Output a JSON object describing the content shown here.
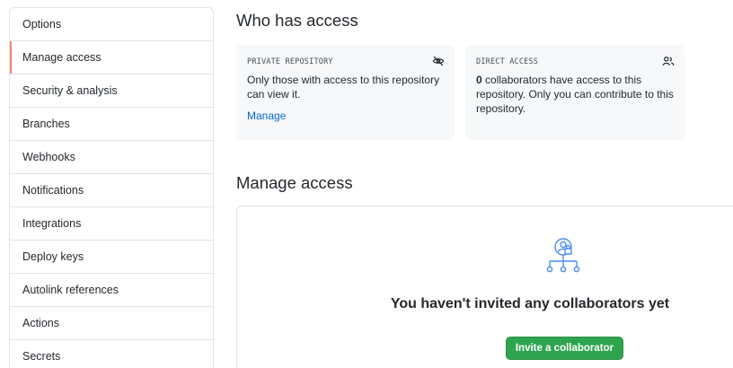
{
  "sidebar": {
    "items": [
      {
        "label": "Options"
      },
      {
        "label": "Manage access"
      },
      {
        "label": "Security & analysis"
      },
      {
        "label": "Branches"
      },
      {
        "label": "Webhooks"
      },
      {
        "label": "Notifications"
      },
      {
        "label": "Integrations"
      },
      {
        "label": "Deploy keys"
      },
      {
        "label": "Autolink references"
      },
      {
        "label": "Actions"
      },
      {
        "label": "Secrets"
      }
    ],
    "selected": "Manage access",
    "accent_color": "#f9826c"
  },
  "who_has_access": {
    "title": "Who has access",
    "private_card": {
      "label": "PRIVATE REPOSITORY",
      "icon": "eye-closed-icon",
      "text": "Only those with access to this repository can view it.",
      "link": "Manage"
    },
    "direct_card": {
      "label": "DIRECT ACCESS",
      "icon": "people-icon",
      "count": "0",
      "text": " collaborators have access to this repository. Only you can contribute to this repository."
    }
  },
  "manage_access": {
    "title": "Manage access",
    "icon": "collaborators-icon",
    "blank_title": "You haven't invited any collaborators yet",
    "invite_button": "Invite a collaborator",
    "button_color": "#2ea44f"
  }
}
